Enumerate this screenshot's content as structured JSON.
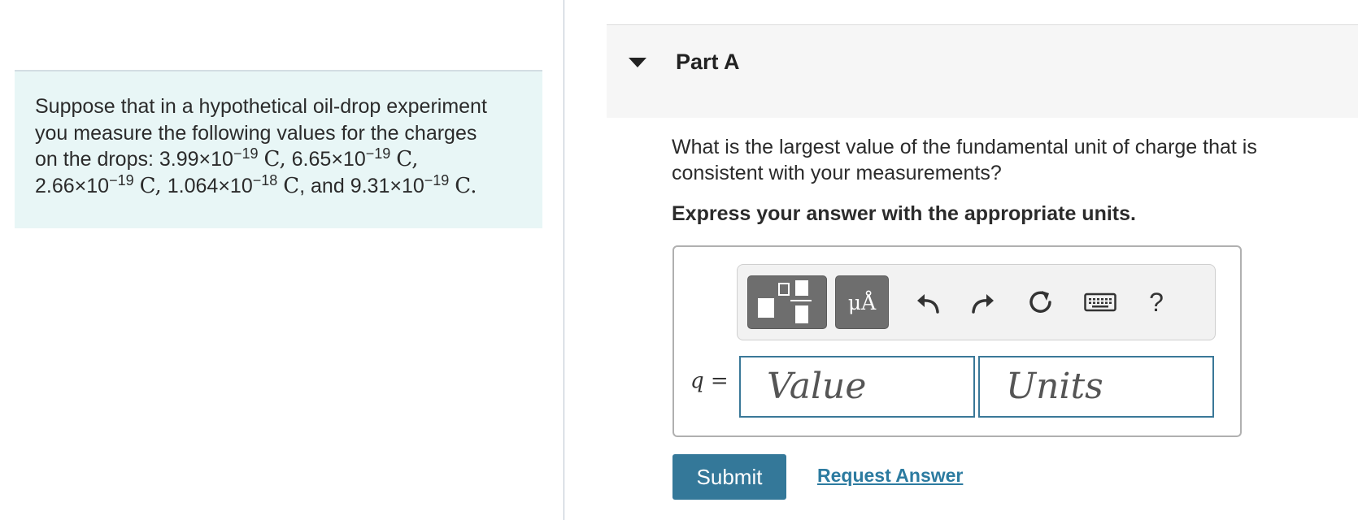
{
  "problem": {
    "line1": "Suppose that in a hypothetical oil-drop experiment",
    "line2": "you measure the following values for the charges",
    "line3_prefix": "on the drops: ",
    "charges": [
      {
        "mantissa": "3.99×10",
        "exponent": "−19",
        "unit": "C"
      },
      {
        "mantissa": "6.65×10",
        "exponent": "−19",
        "unit": "C"
      },
      {
        "mantissa": "2.66×10",
        "exponent": "−19",
        "unit": "C"
      },
      {
        "mantissa": "1.064×10",
        "exponent": "−18",
        "unit": "C"
      },
      {
        "mantissa": "9.31×10",
        "exponent": "−19",
        "unit": "C"
      }
    ],
    "sep_comma": ",",
    "sep_and": ", and",
    "end_period": "."
  },
  "part": {
    "title": "Part A",
    "question": "What is the largest value of the fundamental unit of charge that is consistent with your measurements?",
    "instruction": "Express your answer with the appropriate units."
  },
  "toolbar": {
    "units_label": "μÅ",
    "help_label": "?",
    "icons": [
      "templates-icon",
      "units-icon",
      "undo-icon",
      "redo-icon",
      "reset-icon",
      "keyboard-icon",
      "help-icon"
    ]
  },
  "answer": {
    "variable": "q",
    "equals": "=",
    "value_placeholder": "Value",
    "units_placeholder": "Units"
  },
  "actions": {
    "submit_label": "Submit",
    "request_label": "Request Answer"
  },
  "colors": {
    "problem_bg": "#e8f6f6",
    "accent": "#347899",
    "link": "#2c7ba0"
  }
}
